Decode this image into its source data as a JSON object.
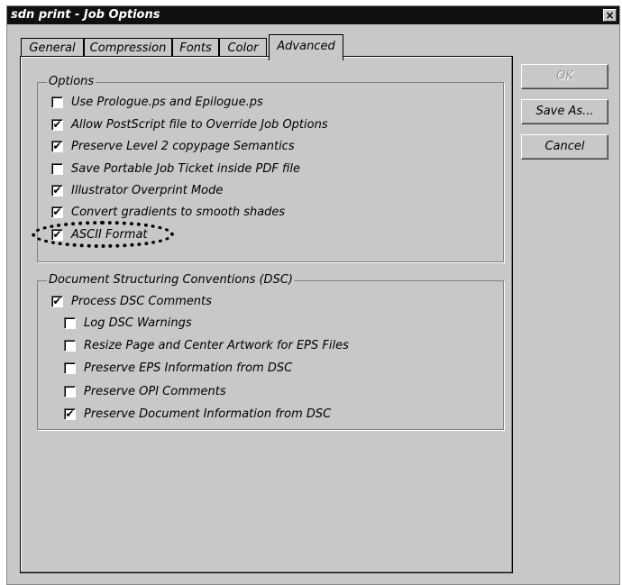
{
  "window": {
    "title": "sdn print - Job Options",
    "close_glyph": "×"
  },
  "tabs": [
    {
      "label": "General",
      "active": false
    },
    {
      "label": "Compression",
      "active": false
    },
    {
      "label": "Fonts",
      "active": false
    },
    {
      "label": "Color",
      "active": false
    },
    {
      "label": "Advanced",
      "active": true
    }
  ],
  "options_group": {
    "title": "Options",
    "items": [
      {
        "label": "Use Prologue.ps and Epilogue.ps",
        "checked": false
      },
      {
        "label": "Allow PostScript file to Override Job Options",
        "checked": true
      },
      {
        "label": "Preserve Level 2 copypage Semantics",
        "checked": true
      },
      {
        "label": "Save Portable Job Ticket inside PDF file",
        "checked": false
      },
      {
        "label": "Illustrator Overprint Mode",
        "checked": true
      },
      {
        "label": "Convert gradients to smooth shades",
        "checked": true
      },
      {
        "label": "ASCII Format",
        "checked": true
      }
    ]
  },
  "dsc_group": {
    "title": "Document Structuring Conventions (DSC)",
    "items": [
      {
        "label": "Process DSC Comments",
        "checked": true
      },
      {
        "label": "Log DSC Warnings",
        "checked": false
      },
      {
        "label": "Resize Page and Center Artwork for EPS Files",
        "checked": false
      },
      {
        "label": "Preserve EPS Information from DSC",
        "checked": false
      },
      {
        "label": "Preserve OPI Comments",
        "checked": false
      },
      {
        "label": "Preserve Document Information from DSC",
        "checked": true
      }
    ]
  },
  "buttons": {
    "ok": "OK",
    "save_as": "Save As...",
    "cancel": "Cancel"
  },
  "check_glyph": "✔"
}
